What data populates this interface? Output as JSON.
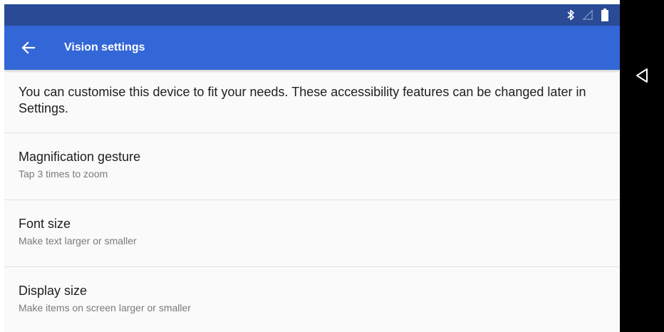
{
  "status_bar": {
    "icons": [
      "bluetooth-icon",
      "signal-icon",
      "battery-icon"
    ]
  },
  "app_bar": {
    "title": "Vision settings",
    "back_icon": "arrow-left-icon"
  },
  "intro": {
    "text": "You can customise this device to fit your needs. These accessibility features can be changed later in Settings."
  },
  "items": [
    {
      "title": "Magnification gesture",
      "summary": "Tap 3 times to zoom"
    },
    {
      "title": "Font size",
      "summary": "Make text larger or smaller"
    },
    {
      "title": "Display size",
      "summary": "Make items on screen larger or smaller"
    }
  ],
  "nav_bar": {
    "back_icon": "triangle-back-icon"
  },
  "colors": {
    "status_bar": "#2a4a96",
    "app_bar": "#3366d6",
    "background": "#fafafa",
    "nav_bar": "#000000"
  }
}
